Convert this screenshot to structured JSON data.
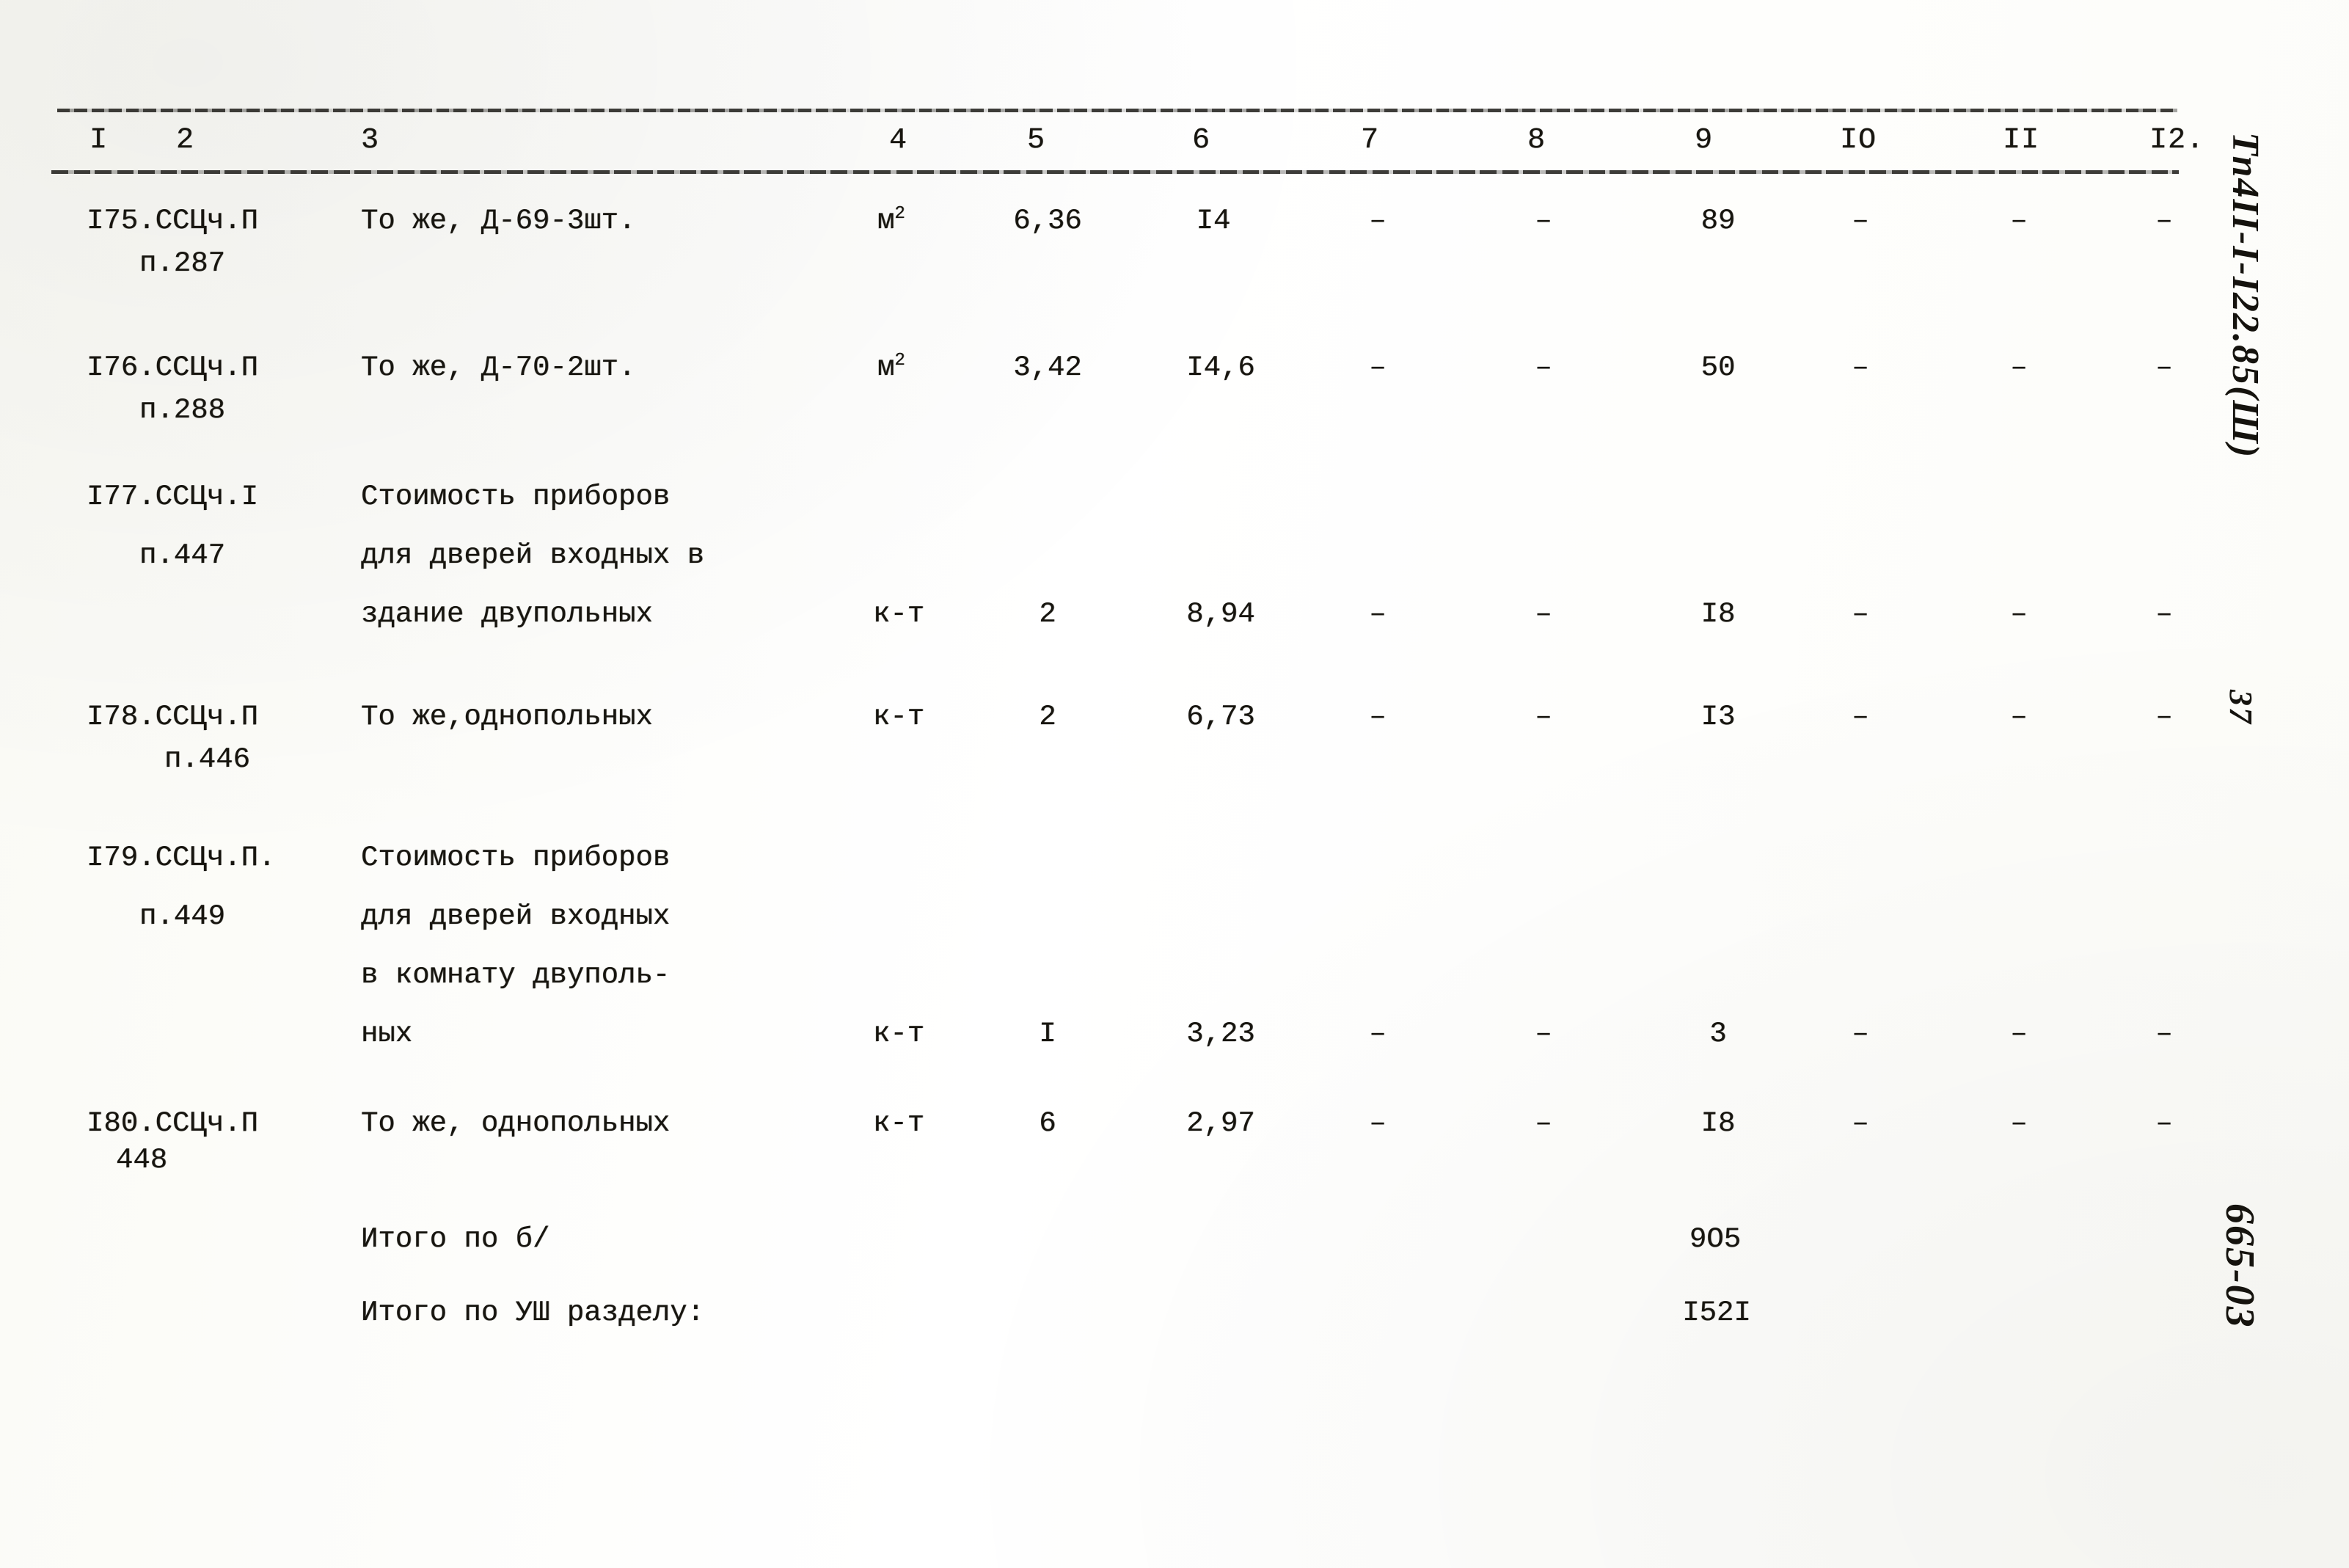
{
  "document": {
    "type": "typewritten-estimate-table",
    "page_number": "37",
    "margin_code_top": "Тп4II-I-I22.85(Ш)",
    "margin_code_bottom": "665-03"
  },
  "table": {
    "column_headers": [
      "I",
      "2",
      "3",
      "4",
      "5",
      "6",
      "7",
      "8",
      "9",
      "IO",
      "II",
      "I2."
    ],
    "rows": [
      {
        "code_lines": [
          "I75.ССЦч.П",
          "п.287"
        ],
        "description_lines": [
          "То же, Д-69-3шт."
        ],
        "unit": "м",
        "unit_sup": "2",
        "c5": "6,36",
        "c6": "I4",
        "c7": "–",
        "c8": "–",
        "c9": "89",
        "c10": "–",
        "c11": "–",
        "c12": "–"
      },
      {
        "code_lines": [
          "I76.ССЦч.П",
          "п.288"
        ],
        "description_lines": [
          "То же, Д-70-2шт."
        ],
        "unit": "м",
        "unit_sup": "2",
        "c5": "3,42",
        "c6": "I4,6",
        "c7": "–",
        "c8": "–",
        "c9": "50",
        "c10": "–",
        "c11": "–",
        "c12": "–"
      },
      {
        "code_lines": [
          "I77.ССЦч.I",
          "п.447"
        ],
        "description_lines": [
          "Стоимость приборов",
          "для дверей входных в",
          "здание двупольных"
        ],
        "unit": "к-т",
        "unit_sup": "",
        "c5": "2",
        "c6": "8,94",
        "c7": "–",
        "c8": "–",
        "c9": "I8",
        "c10": "–",
        "c11": "–",
        "c12": "–"
      },
      {
        "code_lines": [
          "I78.ССЦч.П",
          "п.446"
        ],
        "description_lines": [
          "То же,однопольных"
        ],
        "unit": "к-т",
        "unit_sup": "",
        "c5": "2",
        "c6": "6,73",
        "c7": "–",
        "c8": "–",
        "c9": "I3",
        "c10": "–",
        "c11": "–",
        "c12": "–"
      },
      {
        "code_lines": [
          "I79.ССЦч.П.",
          "п.449"
        ],
        "description_lines": [
          "Стоимость приборов",
          "для дверей входных",
          "в комнату двуполь-",
          "ных"
        ],
        "unit": "к-т",
        "unit_sup": "",
        "c5": "I",
        "c6": "3,23",
        "c7": "–",
        "c8": "–",
        "c9": "3",
        "c10": "–",
        "c11": "–",
        "c12": "–"
      },
      {
        "code_lines": [
          "I80.ССЦч.П",
          "448"
        ],
        "description_lines": [
          "То же, однопольных"
        ],
        "unit": "к-т",
        "unit_sup": "",
        "c5": "6",
        "c6": "2,97",
        "c7": "–",
        "c8": "–",
        "c9": "I8",
        "c10": "–",
        "c11": "–",
        "c12": "–"
      }
    ],
    "totals": [
      {
        "label": "Итого по б/",
        "value": "9O5"
      },
      {
        "label": "Итого по УШ разделу:",
        "value": "I52I"
      }
    ]
  }
}
